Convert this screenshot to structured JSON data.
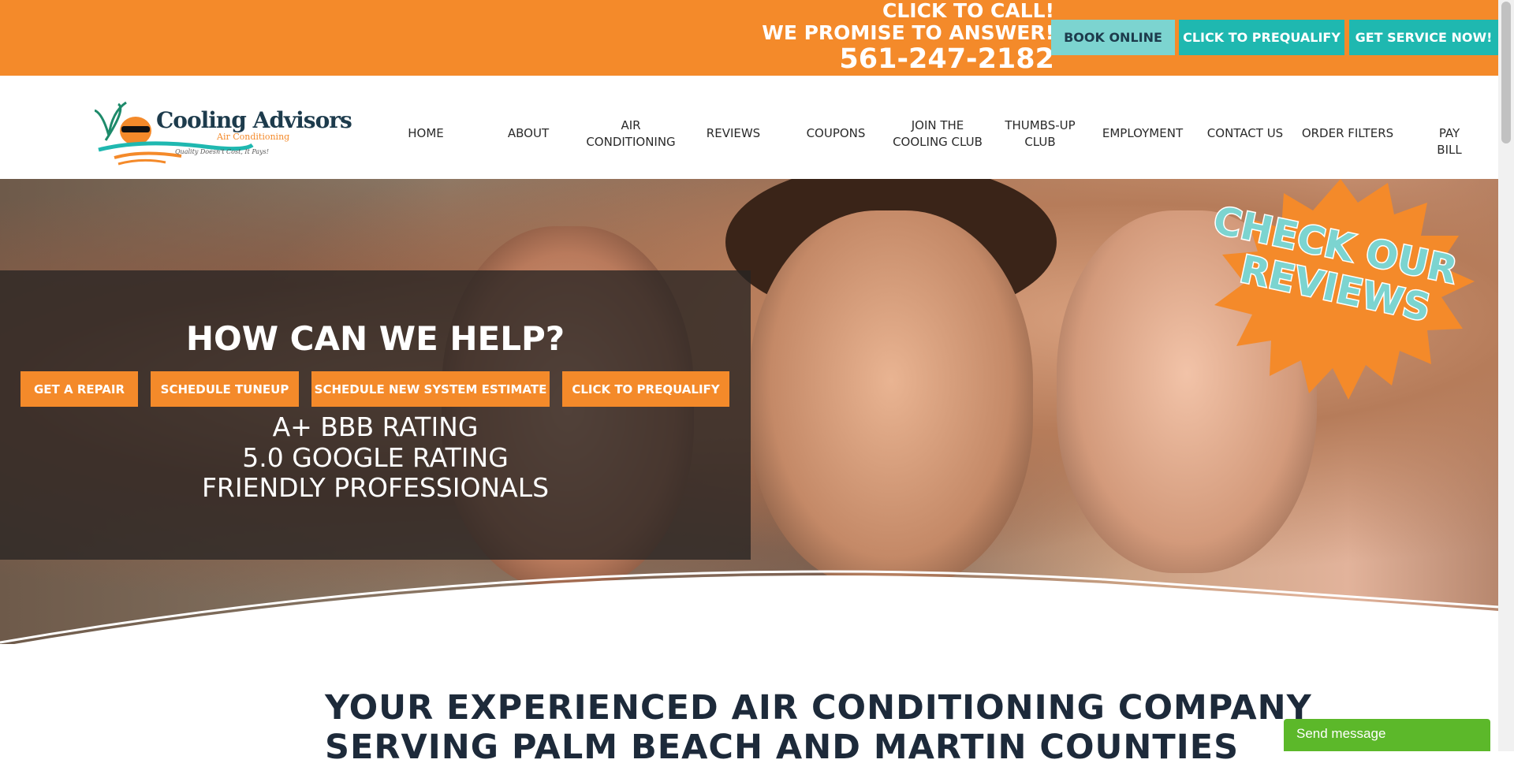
{
  "topbar": {
    "call_line1": "CLICK TO CALL!",
    "call_line2": "WE PROMISE TO ANSWER!",
    "phone": "561-247-2182",
    "book_online": "BOOK ONLINE",
    "prequalify": "CLICK TO PREQUALIFY",
    "get_service": "GET SERVICE NOW!"
  },
  "logo": {
    "name": "Cooling Advisors",
    "sub": "Air Conditioning",
    "tagline": "Quality Doesn't Cost, It Pays!"
  },
  "nav": [
    {
      "label": "HOME"
    },
    {
      "label": "ABOUT"
    },
    {
      "label": "AIR\nCONDITIONING"
    },
    {
      "label": "REVIEWS"
    },
    {
      "label": "COUPONS"
    },
    {
      "label": "JOIN THE\nCOOLING CLUB"
    },
    {
      "label": "THUMBS-UP\nCLUB"
    },
    {
      "label": "EMPLOYMENT"
    },
    {
      "label": "CONTACT US"
    },
    {
      "label": "ORDER FILTERS"
    },
    {
      "label": "PAY BILL"
    }
  ],
  "hero": {
    "heading": "HOW CAN WE HELP?",
    "buttons": [
      {
        "label": "GET A REPAIR"
      },
      {
        "label": "SCHEDULE TUNEUP"
      },
      {
        "label": "SCHEDULE NEW SYSTEM ESTIMATE"
      },
      {
        "label": "CLICK TO PREQUALIFY"
      }
    ],
    "ratings": [
      "A+ BBB RATING",
      "5.0 GOOGLE RATING",
      "FRIENDLY PROFESSIONALS"
    ],
    "badge_line1": "CHECK OUR",
    "badge_line2": "REVIEWS"
  },
  "main": {
    "headline_line1": "YOUR EXPERIENCED AIR CONDITIONING COMPANY",
    "headline_line2": "SERVING PALM BEACH AND MARTIN COUNTIES"
  },
  "chat": {
    "label": "Send message"
  },
  "colors": {
    "orange": "#f48a2a",
    "teal": "#1fb8b0",
    "light_teal": "#7cd4d0",
    "green": "#5cb82a"
  }
}
